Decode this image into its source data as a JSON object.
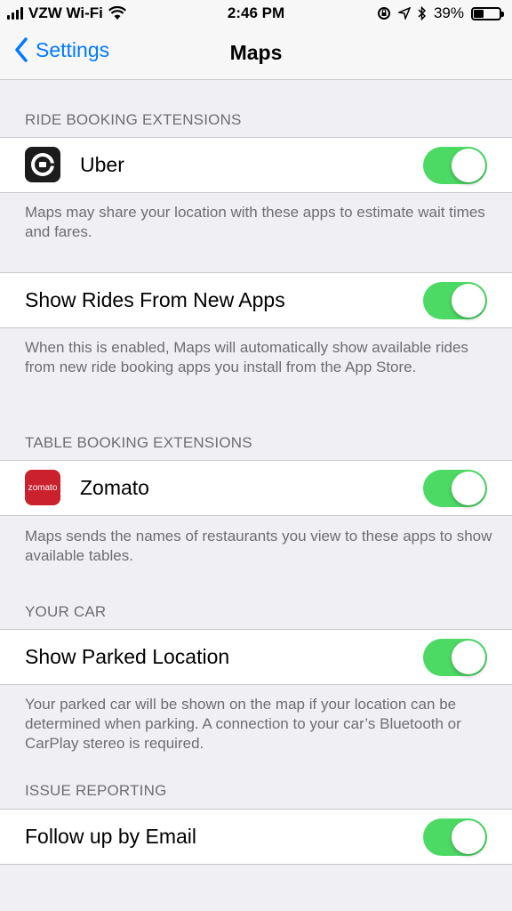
{
  "status_bar": {
    "carrier": "VZW Wi-Fi",
    "time": "2:46 PM",
    "battery_percent": "39%",
    "battery_level": 0.39
  },
  "nav": {
    "back_label": "Settings",
    "title": "Maps"
  },
  "ride_booking": {
    "header": "RIDE BOOKING EXTENSIONS",
    "apps": [
      {
        "name": "Uber",
        "enabled": true,
        "icon": "uber-app-icon"
      }
    ],
    "footer": "Maps may share your location with these apps to estimate wait times and fares."
  },
  "new_apps": {
    "label": "Show Rides From New Apps",
    "enabled": true,
    "footer": "When this is enabled, Maps will automatically show available rides from new ride booking apps you install from the App Store."
  },
  "table_booking": {
    "header": "TABLE BOOKING EXTENSIONS",
    "apps": [
      {
        "name": "Zomato",
        "enabled": true,
        "icon": "zomato-app-icon",
        "icon_text": "zomato"
      }
    ],
    "footer": "Maps sends the names of restaurants you view to these apps to show available tables."
  },
  "your_car": {
    "header": "YOUR CAR",
    "label": "Show Parked Location",
    "enabled": true,
    "footer": "Your parked car will be shown on the map if your location can be determined when parking. A connection to your car’s Bluetooth or CarPlay stereo is required."
  },
  "issue_reporting": {
    "header": "ISSUE REPORTING",
    "label": "Follow up by Email",
    "enabled": true
  },
  "colors": {
    "accent": "#007aff",
    "toggle_on": "#4cd964",
    "background": "#efeff4",
    "footer_text": "#6d6d72"
  }
}
